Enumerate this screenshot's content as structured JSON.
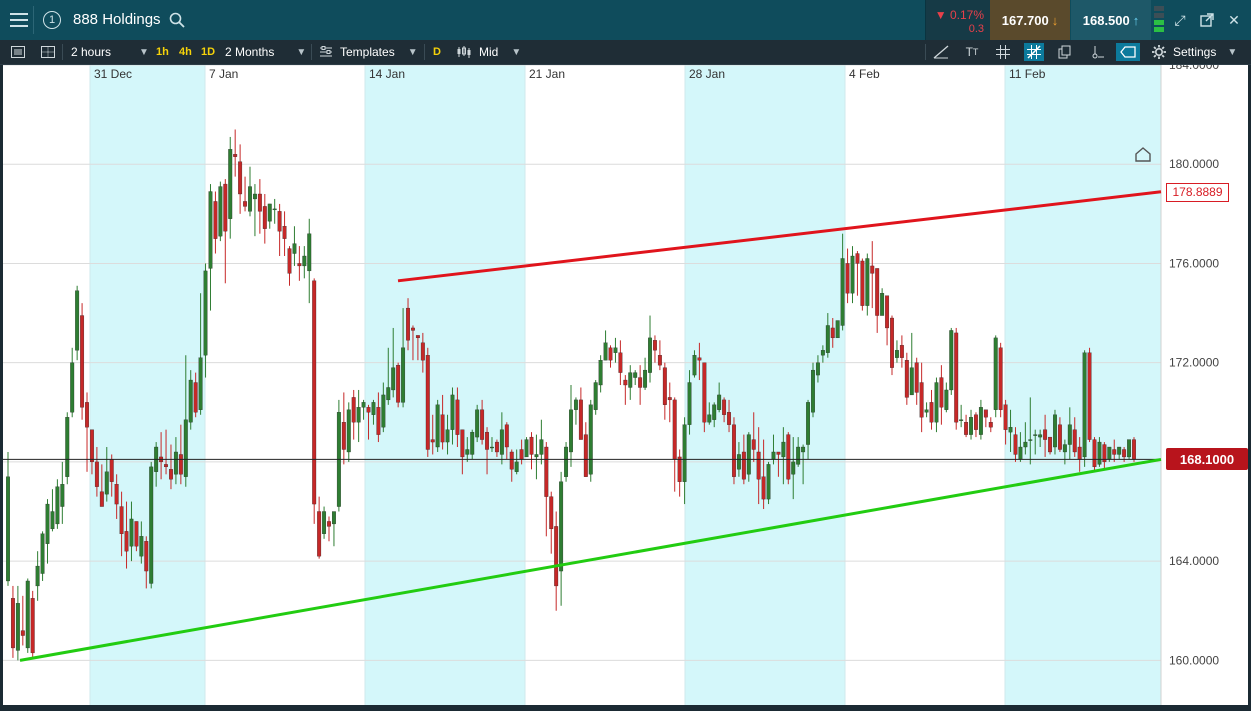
{
  "header": {
    "menu_icon": "hamburger-icon",
    "info_icon": "info-circle-icon",
    "instrument": "888 Holdings",
    "search_icon": "search-icon",
    "change_pct": "▼ 0.17%",
    "change_abs": "0.3",
    "sell_price": "167.700",
    "buy_price": "168.500",
    "window_icons": [
      "signal-bars-icon",
      "expand-icon",
      "popout-icon",
      "close-icon"
    ]
  },
  "toolbar": {
    "interval": "2 hours",
    "quick_intervals": [
      "1h",
      "4h",
      "1D"
    ],
    "range": "2 Months",
    "templates_label": "Templates",
    "d_label": "D",
    "price_type": "Mid",
    "settings_label": "Settings"
  },
  "colors": {
    "resistance": "#e0141c",
    "support": "#22cc11",
    "up_candle": "#2e7d32",
    "down_candle": "#c62828",
    "shade": "#d4f7fa",
    "current_line": "#222222"
  },
  "chart_data": {
    "type": "candlestick",
    "x_ticks": [
      "31 Dec",
      "7 Jan",
      "14 Jan",
      "21 Jan",
      "28 Jan",
      "4 Feb",
      "11 Feb"
    ],
    "y_ticks": [
      "160.0000",
      "164.0000",
      "168.0000",
      "172.0000",
      "176.0000",
      "180.0000",
      "184.0000"
    ],
    "ylim": [
      158.2,
      184.0
    ],
    "current_price": "168.1000",
    "current_value": 168.1,
    "resistance_label": "178.8889",
    "resistance_value": 178.8889,
    "resistance_start": 175.3,
    "support_start": 160.0,
    "support_end": 168.1,
    "weekend_shading": "weekends alternately shaded light cyan",
    "candles": [
      [
        163.2,
        167.4,
        163.0,
        168.4
      ],
      [
        162.5,
        160.5,
        160.1,
        163.0
      ],
      [
        160.4,
        162.3,
        160.0,
        163.0
      ],
      [
        161.2,
        161.0,
        160.6,
        162.6
      ],
      [
        160.5,
        163.2,
        160.3,
        163.3
      ],
      [
        162.5,
        160.3,
        160.1,
        162.8
      ],
      [
        163.0,
        163.8,
        162.4,
        164.4
      ],
      [
        163.5,
        165.1,
        163.2,
        165.2
      ],
      [
        164.7,
        166.3,
        163.9,
        166.5
      ],
      [
        165.3,
        166.0,
        165.2,
        166.9
      ],
      [
        165.5,
        167.0,
        165.3,
        167.3
      ],
      [
        166.2,
        167.1,
        165.5,
        168.0
      ],
      [
        167.4,
        169.8,
        167.1,
        170.0
      ],
      [
        170.0,
        172.0,
        169.8,
        172.6
      ],
      [
        172.5,
        174.9,
        172.1,
        175.1
      ],
      [
        173.9,
        170.2,
        169.7,
        174.4
      ],
      [
        170.4,
        169.4,
        167.6,
        170.8
      ],
      [
        169.3,
        168.0,
        167.5,
        169.3
      ],
      [
        168.0,
        167.0,
        166.6,
        168.6
      ],
      [
        166.8,
        166.2,
        166.2,
        167.9
      ],
      [
        166.7,
        167.6,
        166.4,
        168.6
      ],
      [
        168.1,
        167.2,
        166.6,
        168.3
      ],
      [
        167.1,
        166.3,
        165.7,
        167.5
      ],
      [
        166.2,
        165.1,
        164.2,
        166.8
      ],
      [
        165.2,
        164.4,
        163.7,
        166.4
      ],
      [
        164.6,
        165.7,
        164.0,
        166.4
      ],
      [
        165.6,
        164.6,
        164.4,
        165.6
      ],
      [
        164.2,
        165.0,
        163.9,
        165.6
      ],
      [
        164.8,
        163.6,
        162.9,
        165.0
      ],
      [
        163.1,
        167.8,
        162.9,
        168.0
      ],
      [
        167.6,
        168.6,
        167.0,
        168.8
      ],
      [
        168.2,
        168.0,
        167.3,
        169.2
      ],
      [
        167.9,
        167.8,
        167.5,
        169.3
      ],
      [
        167.7,
        167.3,
        166.9,
        168.7
      ],
      [
        167.5,
        168.4,
        167.1,
        169.0
      ],
      [
        168.3,
        167.5,
        167.1,
        169.5
      ],
      [
        167.4,
        169.7,
        167.0,
        172.3
      ],
      [
        169.6,
        171.3,
        169.3,
        171.7
      ],
      [
        171.2,
        170.0,
        169.8,
        171.6
      ],
      [
        170.1,
        172.2,
        169.9,
        174.8
      ],
      [
        172.3,
        175.7,
        171.4,
        176.0
      ],
      [
        175.8,
        178.9,
        174.1,
        179.2
      ],
      [
        178.5,
        177.0,
        176.4,
        178.9
      ],
      [
        177.1,
        179.1,
        176.9,
        179.3
      ],
      [
        179.2,
        177.3,
        175.2,
        179.4
      ],
      [
        177.8,
        180.6,
        177.0,
        181.1
      ],
      [
        180.4,
        180.3,
        179.5,
        181.4
      ],
      [
        180.1,
        178.8,
        178.0,
        180.8
      ],
      [
        178.5,
        178.3,
        178.1,
        179.5
      ],
      [
        178.1,
        179.1,
        177.9,
        179.9
      ],
      [
        178.6,
        178.8,
        177.1,
        179.2
      ],
      [
        178.8,
        178.1,
        177.2,
        179.4
      ],
      [
        178.3,
        177.4,
        176.8,
        178.8
      ],
      [
        177.7,
        178.4,
        177.4,
        178.4
      ],
      [
        178.2,
        178.2,
        177.6,
        178.6
      ],
      [
        178.1,
        177.3,
        176.3,
        178.4
      ],
      [
        177.5,
        177.0,
        176.3,
        178.1
      ],
      [
        176.6,
        175.6,
        175.1,
        176.7
      ],
      [
        176.4,
        176.8,
        175.9,
        177.5
      ],
      [
        176.0,
        175.9,
        175.3,
        176.7
      ],
      [
        175.9,
        176.3,
        175.4,
        176.7
      ],
      [
        175.7,
        177.2,
        174.4,
        177.8
      ],
      [
        175.3,
        166.3,
        165.5,
        175.4
      ],
      [
        166.0,
        164.2,
        164.1,
        166.6
      ],
      [
        165.1,
        166.0,
        164.9,
        166.2
      ],
      [
        165.6,
        165.4,
        164.8,
        165.8
      ],
      [
        165.5,
        166.0,
        164.6,
        166.0
      ],
      [
        166.2,
        170.0,
        166.0,
        170.5
      ],
      [
        169.6,
        168.5,
        167.9,
        170.8
      ],
      [
        168.4,
        170.1,
        168.0,
        170.4
      ],
      [
        170.6,
        169.6,
        168.9,
        170.9
      ],
      [
        169.6,
        170.2,
        168.8,
        170.9
      ],
      [
        170.2,
        170.4,
        169.7,
        170.5
      ],
      [
        170.2,
        170.0,
        168.9,
        170.3
      ],
      [
        169.9,
        170.4,
        169.5,
        170.5
      ],
      [
        170.2,
        169.1,
        168.8,
        170.8
      ],
      [
        169.4,
        170.7,
        169.2,
        171.2
      ],
      [
        170.5,
        171.0,
        170.3,
        172.6
      ],
      [
        170.9,
        171.8,
        170.6,
        173.4
      ],
      [
        171.9,
        170.4,
        170.2,
        172.0
      ],
      [
        170.4,
        172.6,
        170.2,
        174.2
      ],
      [
        174.2,
        172.9,
        172.5,
        174.6
      ],
      [
        173.4,
        173.3,
        172.1,
        173.5
      ],
      [
        173.1,
        173.0,
        172.1,
        173.1
      ],
      [
        172.8,
        172.1,
        171.6,
        173.2
      ],
      [
        172.3,
        168.5,
        168.2,
        172.6
      ],
      [
        168.9,
        168.8,
        168.3,
        169.9
      ],
      [
        168.6,
        170.3,
        168.4,
        170.5
      ],
      [
        169.9,
        168.8,
        168.5,
        170.7
      ],
      [
        168.8,
        169.3,
        168.3,
        169.9
      ],
      [
        169.3,
        170.7,
        168.7,
        171.0
      ],
      [
        170.5,
        169.1,
        168.6,
        171.0
      ],
      [
        169.3,
        168.2,
        167.5,
        169.3
      ],
      [
        168.3,
        168.5,
        168.0,
        169.0
      ],
      [
        168.3,
        169.2,
        168.1,
        169.3
      ],
      [
        169.0,
        170.1,
        168.8,
        170.3
      ],
      [
        170.1,
        168.9,
        168.7,
        170.5
      ],
      [
        169.2,
        168.5,
        167.5,
        169.4
      ],
      [
        168.6,
        168.6,
        168.4,
        169.0
      ],
      [
        168.8,
        168.4,
        168.2,
        168.9
      ],
      [
        168.3,
        169.3,
        167.9,
        170.0
      ],
      [
        169.5,
        168.6,
        168.1,
        169.6
      ],
      [
        168.4,
        167.7,
        167.2,
        168.5
      ],
      [
        167.6,
        168.0,
        167.5,
        168.5
      ],
      [
        168.5,
        168.1,
        167.9,
        168.9
      ],
      [
        168.2,
        168.9,
        168.2,
        169.0
      ],
      [
        169.0,
        168.3,
        167.7,
        169.2
      ],
      [
        168.2,
        168.3,
        167.3,
        169.1
      ],
      [
        168.3,
        168.9,
        167.9,
        169.7
      ],
      [
        168.6,
        166.6,
        165.0,
        168.8
      ],
      [
        166.6,
        165.3,
        164.3,
        166.8
      ],
      [
        165.4,
        163.0,
        162.0,
        166.0
      ],
      [
        163.6,
        167.2,
        162.2,
        167.6
      ],
      [
        167.4,
        168.6,
        167.2,
        168.8
      ],
      [
        168.4,
        170.1,
        167.8,
        171.1
      ],
      [
        170.1,
        170.5,
        169.5,
        170.6
      ],
      [
        170.5,
        168.9,
        168.9,
        171.0
      ],
      [
        169.1,
        167.4,
        167.4,
        169.6
      ],
      [
        167.5,
        170.3,
        167.2,
        170.5
      ],
      [
        170.1,
        171.2,
        169.9,
        171.3
      ],
      [
        171.1,
        172.1,
        170.8,
        172.3
      ],
      [
        172.1,
        172.8,
        172.1,
        173.3
      ],
      [
        172.6,
        172.1,
        171.8,
        172.7
      ],
      [
        172.4,
        172.6,
        172.0,
        173.0
      ],
      [
        172.4,
        171.6,
        171.1,
        172.9
      ],
      [
        171.3,
        171.1,
        170.3,
        171.5
      ],
      [
        171.0,
        171.6,
        170.5,
        171.9
      ],
      [
        171.4,
        171.6,
        171.1,
        171.7
      ],
      [
        171.4,
        171.0,
        170.3,
        171.9
      ],
      [
        171.0,
        171.7,
        170.9,
        172.2
      ],
      [
        171.6,
        173.0,
        171.2,
        173.9
      ],
      [
        172.9,
        172.5,
        172.0,
        173.1
      ],
      [
        172.3,
        171.9,
        171.7,
        172.9
      ],
      [
        171.8,
        170.3,
        169.7,
        172.0
      ],
      [
        170.6,
        170.5,
        169.6,
        171.2
      ],
      [
        170.5,
        168.1,
        166.8,
        170.6
      ],
      [
        168.2,
        167.2,
        166.6,
        168.5
      ],
      [
        167.2,
        169.5,
        166.3,
        169.8
      ],
      [
        169.5,
        171.2,
        169.1,
        171.7
      ],
      [
        171.5,
        172.3,
        171.4,
        172.5
      ],
      [
        172.2,
        172.1,
        171.3,
        172.8
      ],
      [
        172.0,
        169.6,
        169.2,
        172.0
      ],
      [
        169.6,
        169.9,
        169.5,
        170.4
      ],
      [
        169.7,
        170.3,
        169.4,
        170.4
      ],
      [
        170.1,
        170.7,
        170.0,
        171.2
      ],
      [
        170.5,
        169.9,
        169.6,
        170.6
      ],
      [
        170.0,
        169.5,
        169.2,
        170.5
      ],
      [
        169.5,
        167.4,
        167.1,
        169.8
      ],
      [
        167.7,
        168.3,
        167.4,
        168.8
      ],
      [
        168.4,
        167.3,
        167.1,
        169.1
      ],
      [
        167.5,
        169.1,
        167.2,
        169.2
      ],
      [
        168.9,
        168.5,
        168.0,
        170.0
      ],
      [
        168.4,
        167.3,
        166.3,
        169.4
      ],
      [
        167.4,
        166.5,
        166.1,
        168.9
      ],
      [
        166.5,
        167.9,
        166.3,
        168.0
      ],
      [
        168.1,
        168.4,
        167.9,
        169.1
      ],
      [
        168.4,
        168.3,
        167.4,
        168.3
      ],
      [
        168.2,
        168.8,
        167.1,
        169.4
      ],
      [
        169.1,
        167.3,
        167.1,
        169.2
      ],
      [
        167.5,
        168.0,
        166.5,
        169.0
      ],
      [
        167.9,
        168.6,
        167.8,
        169.0
      ],
      [
        168.4,
        168.6,
        167.1,
        168.7
      ],
      [
        168.7,
        170.4,
        168.1,
        170.5
      ],
      [
        170.0,
        171.7,
        169.8,
        172.0
      ],
      [
        171.5,
        172.0,
        171.2,
        172.3
      ],
      [
        172.3,
        172.5,
        172.0,
        172.7
      ],
      [
        172.4,
        173.5,
        172.2,
        174.0
      ],
      [
        173.4,
        173.0,
        172.6,
        173.8
      ],
      [
        173.0,
        173.7,
        173.0,
        173.7
      ],
      [
        173.5,
        176.2,
        173.3,
        177.2
      ],
      [
        176.0,
        174.8,
        174.4,
        176.6
      ],
      [
        174.8,
        176.3,
        174.4,
        176.7
      ],
      [
        176.4,
        176.0,
        174.7,
        176.5
      ],
      [
        176.1,
        174.3,
        174.1,
        176.2
      ],
      [
        174.3,
        176.2,
        173.9,
        176.4
      ],
      [
        175.9,
        175.6,
        174.2,
        176.9
      ],
      [
        175.8,
        173.9,
        173.2,
        175.8
      ],
      [
        173.9,
        174.8,
        173.9,
        175.0
      ],
      [
        174.7,
        173.4,
        172.7,
        174.7
      ],
      [
        173.8,
        171.8,
        171.5,
        173.9
      ],
      [
        172.2,
        172.5,
        172.0,
        172.9
      ],
      [
        172.7,
        172.2,
        171.8,
        173.1
      ],
      [
        172.1,
        170.6,
        170.3,
        172.4
      ],
      [
        170.7,
        171.8,
        170.7,
        173.2
      ],
      [
        172.0,
        170.8,
        170.3,
        172.2
      ],
      [
        171.2,
        169.8,
        169.2,
        172.0
      ],
      [
        170.0,
        170.1,
        169.8,
        170.4
      ],
      [
        170.4,
        169.6,
        169.3,
        170.9
      ],
      [
        169.6,
        171.2,
        169.2,
        171.4
      ],
      [
        171.4,
        170.2,
        169.5,
        171.9
      ],
      [
        170.1,
        170.9,
        170.0,
        171.2
      ],
      [
        170.9,
        173.3,
        170.7,
        173.4
      ],
      [
        173.2,
        169.6,
        169.3,
        173.4
      ],
      [
        169.7,
        169.7,
        169.4,
        170.3
      ],
      [
        169.6,
        169.1,
        169.0,
        169.9
      ],
      [
        169.1,
        169.8,
        168.9,
        170.1
      ],
      [
        169.9,
        169.3,
        169.0,
        170.0
      ],
      [
        169.1,
        170.2,
        168.9,
        170.5
      ],
      [
        170.1,
        169.8,
        169.4,
        170.1
      ],
      [
        169.6,
        169.4,
        169.2,
        169.8
      ],
      [
        170.1,
        173.0,
        169.8,
        173.1
      ],
      [
        172.6,
        170.1,
        169.8,
        172.8
      ],
      [
        170.3,
        169.3,
        168.7,
        170.5
      ],
      [
        169.2,
        169.4,
        168.4,
        170.1
      ],
      [
        169.1,
        168.3,
        168.0,
        169.4
      ],
      [
        168.1,
        168.6,
        168.0,
        169.2
      ],
      [
        168.6,
        168.8,
        168.3,
        169.6
      ],
      [
        168.9,
        168.9,
        167.9,
        170.6
      ],
      [
        169.1,
        169.1,
        168.3,
        169.3
      ],
      [
        169.0,
        169.1,
        168.6,
        169.3
      ],
      [
        169.3,
        168.9,
        168.2,
        169.9
      ],
      [
        169.0,
        168.4,
        168.3,
        169.0
      ],
      [
        168.6,
        169.9,
        168.3,
        170.1
      ],
      [
        169.5,
        168.5,
        168.4,
        169.8
      ],
      [
        168.4,
        168.7,
        167.9,
        168.9
      ],
      [
        168.7,
        169.5,
        168.1,
        170.2
      ],
      [
        169.3,
        168.4,
        168.2,
        169.8
      ],
      [
        168.6,
        168.1,
        167.6,
        169.0
      ],
      [
        168.2,
        172.4,
        167.8,
        172.5
      ],
      [
        172.4,
        168.9,
        168.8,
        172.6
      ],
      [
        168.9,
        167.8,
        167.6,
        169.0
      ],
      [
        167.9,
        168.8,
        167.8,
        169.0
      ],
      [
        168.7,
        168.0,
        167.7,
        168.8
      ],
      [
        168.1,
        168.6,
        168.0,
        168.6
      ],
      [
        168.5,
        168.3,
        168.0,
        168.9
      ],
      [
        168.3,
        168.6,
        168.1,
        168.6
      ],
      [
        168.5,
        168.2,
        168.0,
        168.6
      ],
      [
        168.2,
        168.9,
        168.1,
        168.9
      ],
      [
        168.9,
        168.1,
        168.0,
        169.0
      ]
    ]
  }
}
